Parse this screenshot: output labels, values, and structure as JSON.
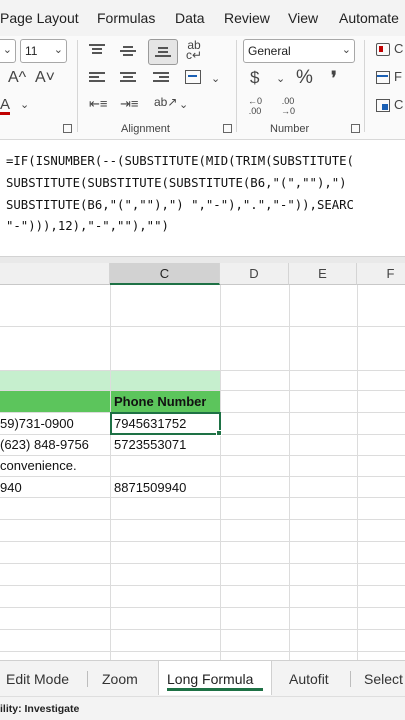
{
  "menu": {
    "items": [
      "Page Layout",
      "Formulas",
      "Data",
      "Review",
      "View",
      "Automate"
    ]
  },
  "ribbon": {
    "font_size": "11",
    "number_format": "General",
    "alignment_label": "Alignment",
    "number_label": "Number",
    "icons": [
      "increase-font-size-icon",
      "decrease-font-size-icon",
      "font-color-icon",
      "align-top-icon",
      "align-middle-icon",
      "align-bottom-icon",
      "wrap-text-icon",
      "align-left-icon",
      "align-center-icon",
      "align-right-icon",
      "merge-center-icon",
      "decrease-indent-icon",
      "increase-indent-icon",
      "text-orientation-icon",
      "currency-icon",
      "percent-icon",
      "comma-style-icon",
      "increase-decimal-icon",
      "decrease-decimal-icon",
      "conditional-formatting-icon",
      "format-as-table-icon",
      "cell-styles-icon"
    ],
    "glyphs": {
      "font_up": "A^",
      "font_down": "A˅",
      "font_color": "A",
      "wrap": "ab",
      "wrap_sub": "c↵",
      "currency": "$",
      "percent": "%",
      "comma": "❜",
      "dec_inc": "←0\n.00",
      "dec_dec": ".00\n→0",
      "orientation": "ab↗"
    }
  },
  "formula": {
    "lines": [
      "=IF(ISNUMBER(--(SUBSTITUTE(MID(TRIM(SUBSTITUTE(",
      "SUBSTITUTE(SUBSTITUTE(SUBSTITUTE(B6,\"(\",\"\"),\")",
      "SUBSTITUTE(B6,\"(\",\"\"),\") \",\"-\"),\".\",\"-\")),SEARC",
      "\"-\"))),12),\"-\",\"\"),\"\")"
    ]
  },
  "columns": [
    "C",
    "D",
    "E",
    "F"
  ],
  "table": {
    "header": "Phone Number",
    "rows": [
      {
        "b": "59)731-0900",
        "c": "7945631752"
      },
      {
        "b": "(623) 848-9756",
        "c": "5723553071"
      },
      {
        "b": " convenience.",
        "c": ""
      },
      {
        "b": "940",
        "c": "8871509940"
      }
    ]
  },
  "tabs": [
    "Edit Mode",
    "Zoom",
    "Long Formula",
    "Autofit",
    "Select"
  ],
  "active_tab": "Long Formula",
  "status": "ility: Investigate",
  "colors": {
    "accent_green": "#1e7145",
    "header_fill": "#5cc55c",
    "light_green": "#c6efce",
    "font_color_red": "#c00000"
  }
}
